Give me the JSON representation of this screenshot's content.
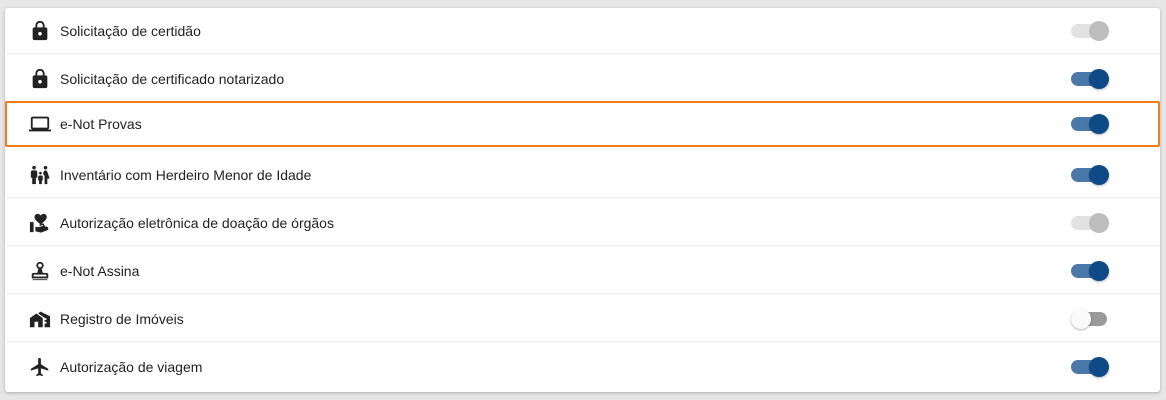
{
  "services": [
    {
      "label": "Solicitação de certidão",
      "icon": "lock-icon",
      "state": "disabled"
    },
    {
      "label": "Solicitação de certificado notarizado",
      "icon": "lock-icon",
      "state": "on"
    },
    {
      "label": "e-Not Provas",
      "icon": "laptop-icon",
      "state": "on",
      "highlighted": true
    },
    {
      "label": "Inventário com Herdeiro Menor de Idade",
      "icon": "family-icon",
      "state": "on"
    },
    {
      "label": "Autorização eletrônica de doação de órgãos",
      "icon": "volunteer-heart-icon",
      "state": "disabled"
    },
    {
      "label": "e-Not Assina",
      "icon": "stamp-icon",
      "state": "on"
    },
    {
      "label": "Registro de Imóveis",
      "icon": "houses-icon",
      "state": "off"
    },
    {
      "label": "Autorização de viagem",
      "icon": "airplane-icon",
      "state": "on"
    }
  ],
  "colors": {
    "toggle_on_knob": "#0e4a86",
    "toggle_on_track": "#4a78a8",
    "highlight_border": "#f07c1c"
  }
}
